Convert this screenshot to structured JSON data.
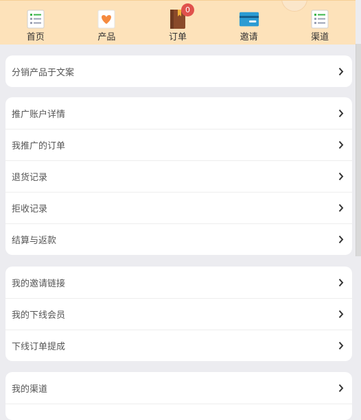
{
  "nav": {
    "items": [
      {
        "label": "首页",
        "icon": "list-icon"
      },
      {
        "label": "产品",
        "icon": "heart-icon"
      },
      {
        "label": "订单",
        "icon": "notebook-icon",
        "badge": "0"
      },
      {
        "label": "邀请",
        "icon": "credit-card-icon"
      },
      {
        "label": "渠道",
        "icon": "list-icon"
      }
    ]
  },
  "sections": [
    {
      "rows": [
        "分销产品于文案"
      ]
    },
    {
      "rows": [
        "推广账户详情",
        "我推广的订单",
        "退货记录",
        "拒收记录",
        "结算与返款"
      ]
    },
    {
      "rows": [
        "我的邀请链接",
        "我的下线会员",
        "下线订单提成"
      ]
    },
    {
      "rows": [
        "我的渠道"
      ]
    }
  ],
  "colors": {
    "nav_bg": "#fde2ba",
    "page_bg": "#ececf0",
    "badge": "#e0514c"
  }
}
